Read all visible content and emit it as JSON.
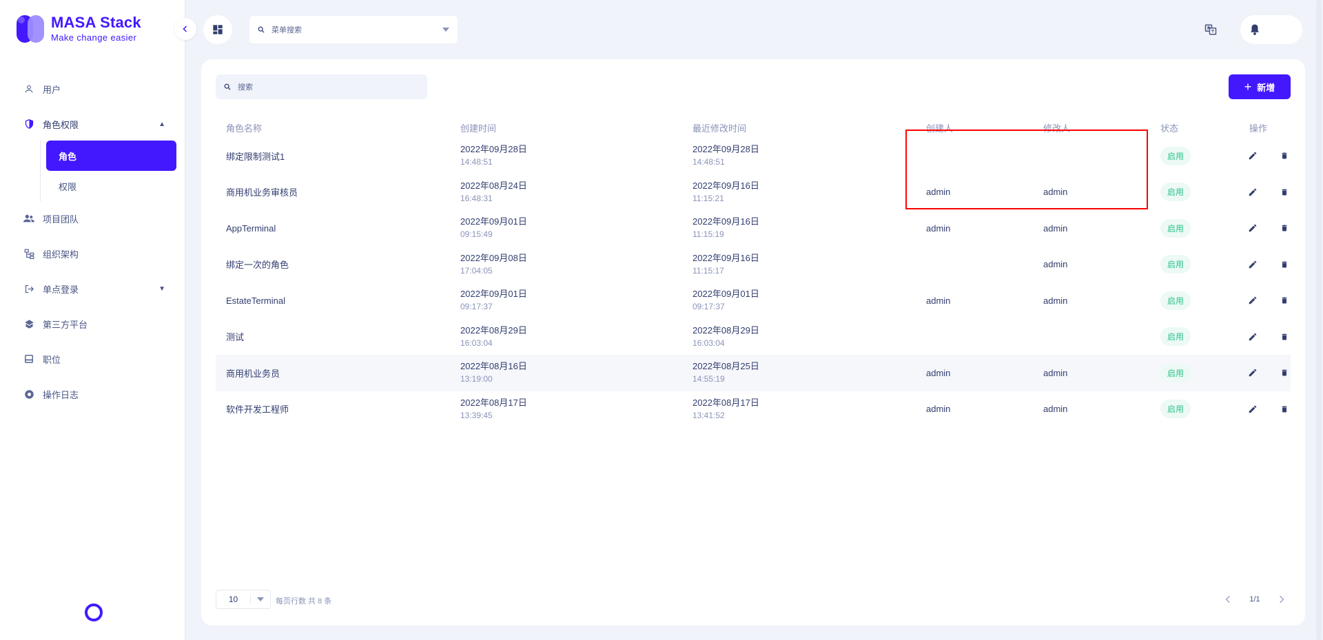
{
  "brand": {
    "title": "MASA Stack",
    "subtitle": "Make change easier"
  },
  "sidebar": {
    "items": [
      {
        "label": "用户",
        "icon": "user-icon"
      },
      {
        "label": "角色权限",
        "icon": "shield-icon",
        "expanded": true,
        "children": [
          {
            "label": "角色",
            "active": true
          },
          {
            "label": "权限",
            "active": false
          }
        ]
      },
      {
        "label": "项目团队",
        "icon": "team-icon"
      },
      {
        "label": "组织架构",
        "icon": "org-chart-icon"
      },
      {
        "label": "单点登录",
        "icon": "login-icon",
        "expanded": false
      },
      {
        "label": "第三方平台",
        "icon": "platform-icon"
      },
      {
        "label": "职位",
        "icon": "position-icon"
      },
      {
        "label": "操作日志",
        "icon": "log-icon"
      }
    ]
  },
  "topbar": {
    "menu_search_placeholder": "菜单搜索"
  },
  "main": {
    "search_placeholder": "搜索",
    "add_label": "新增",
    "columns": [
      "角色名称",
      "创建时间",
      "最近修改时间",
      "创建人",
      "修改人",
      "状态",
      "操作"
    ],
    "rows": [
      {
        "name": "绑定限制测试1",
        "created_date": "2022年09月28日",
        "created_time": "14:48:51",
        "modified_date": "2022年09月28日",
        "modified_time": "14:48:51",
        "creator": "",
        "modifier": "",
        "status": "启用"
      },
      {
        "name": "商用机业务审核员",
        "created_date": "2022年08月24日",
        "created_time": "16:48:31",
        "modified_date": "2022年09月16日",
        "modified_time": "11:15:21",
        "creator": "admin",
        "modifier": "admin",
        "status": "启用"
      },
      {
        "name": "AppTerminal",
        "created_date": "2022年09月01日",
        "created_time": "09:15:49",
        "modified_date": "2022年09月16日",
        "modified_time": "11:15:19",
        "creator": "admin",
        "modifier": "admin",
        "status": "启用"
      },
      {
        "name": "绑定一次的角色",
        "created_date": "2022年09月08日",
        "created_time": "17:04:05",
        "modified_date": "2022年09月16日",
        "modified_time": "11:15:17",
        "creator": "",
        "modifier": "admin",
        "status": "启用"
      },
      {
        "name": "EstateTerminal",
        "created_date": "2022年09月01日",
        "created_time": "09:17:37",
        "modified_date": "2022年09月01日",
        "modified_time": "09:17:37",
        "creator": "admin",
        "modifier": "admin",
        "status": "启用"
      },
      {
        "name": "测试",
        "created_date": "2022年08月29日",
        "created_time": "16:03:04",
        "modified_date": "2022年08月29日",
        "modified_time": "16:03:04",
        "creator": "",
        "modifier": "",
        "status": "启用"
      },
      {
        "name": "商用机业务员",
        "created_date": "2022年08月16日",
        "created_time": "13:19:00",
        "modified_date": "2022年08月25日",
        "modified_time": "14:55:19",
        "creator": "admin",
        "modifier": "admin",
        "status": "启用"
      },
      {
        "name": "软件开发工程师",
        "created_date": "2022年08月17日",
        "created_time": "13:39:45",
        "modified_date": "2022年08月17日",
        "modified_time": "13:41:52",
        "creator": "admin",
        "modifier": "admin",
        "status": "启用"
      }
    ]
  },
  "pagination": {
    "page_size": "10",
    "rows_per_page_label": "每页行数",
    "total_label": "共 8 条",
    "page_indicator": "1/1"
  },
  "colors": {
    "accent": "#4318ff",
    "status_enabled": "#2bc48a",
    "annotation": "#ff0000"
  }
}
